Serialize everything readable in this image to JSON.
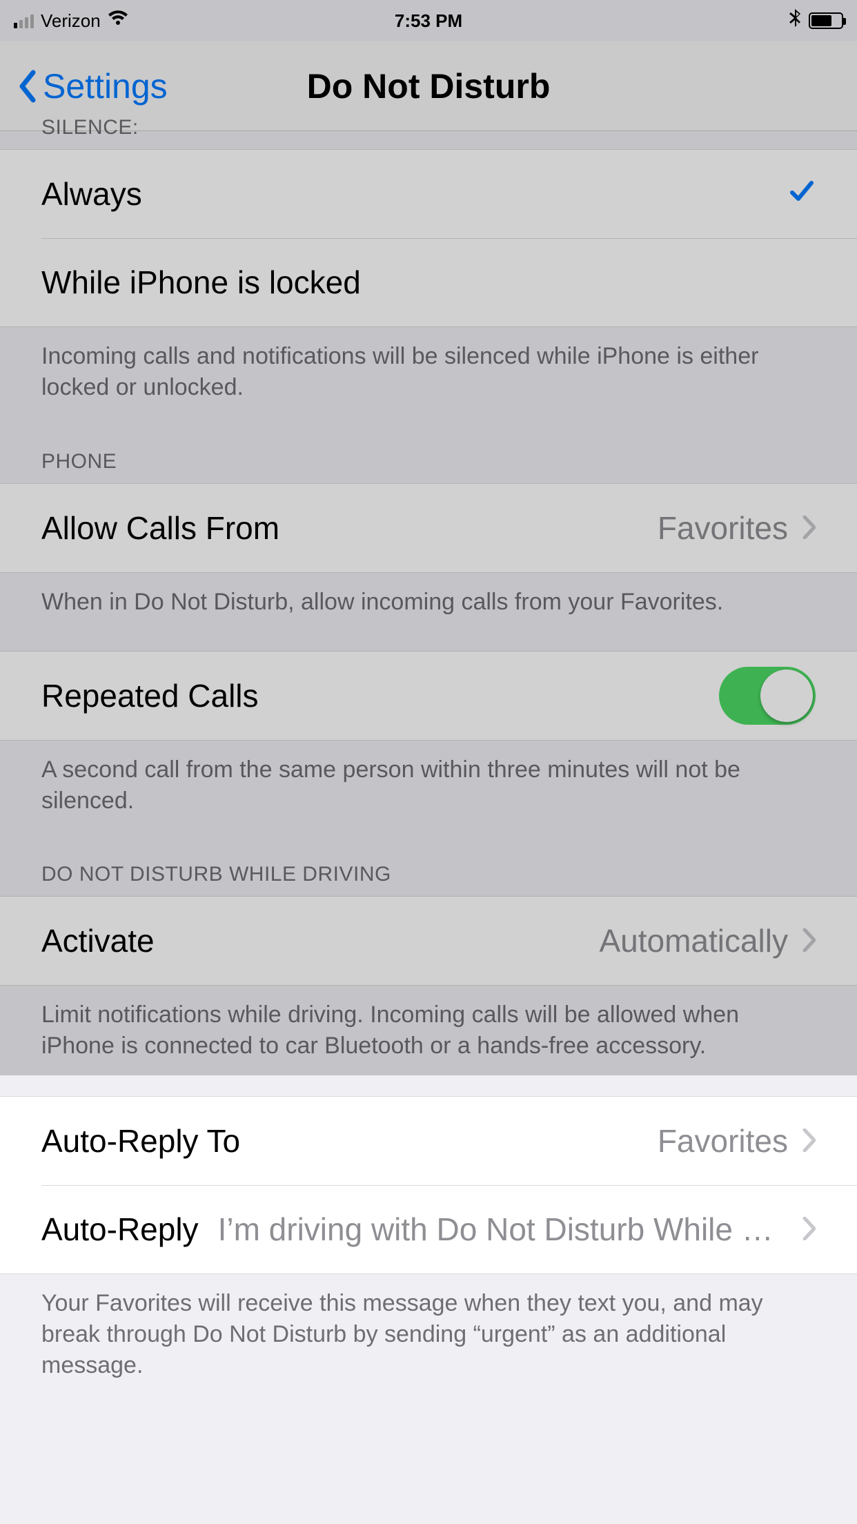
{
  "status": {
    "carrier": "Verizon",
    "time": "7:53 PM"
  },
  "nav": {
    "back_label": "Settings",
    "title": "Do Not Disturb"
  },
  "silence": {
    "header": "SILENCE:",
    "option_always": "Always",
    "option_locked": "While iPhone is locked",
    "footer": "Incoming calls and notifications will be silenced while iPhone is either locked or unlocked."
  },
  "phone": {
    "header": "PHONE",
    "allow_calls_label": "Allow Calls From",
    "allow_calls_value": "Favorites",
    "allow_calls_footer": "When in Do Not Disturb, allow incoming calls from your Favorites.",
    "repeated_label": "Repeated Calls",
    "repeated_footer": "A second call from the same person within three minutes will not be silenced."
  },
  "driving": {
    "header": "DO NOT DISTURB WHILE DRIVING",
    "activate_label": "Activate",
    "activate_value": "Automatically",
    "activate_footer": "Limit notifications while driving. Incoming calls will be allowed when iPhone is connected to car Bluetooth or a hands-free accessory."
  },
  "autoreply": {
    "to_label": "Auto-Reply To",
    "to_value": "Favorites",
    "reply_label": "Auto-Reply",
    "reply_value": "I’m driving with Do Not Disturb While Dri…",
    "footer": "Your Favorites will receive this message when they text you, and may break through Do Not Disturb by sending “urgent” as an additional message."
  },
  "colors": {
    "tint": "#007aff",
    "toggle_on": "#4cd964",
    "secondary": "#8e8e93"
  }
}
